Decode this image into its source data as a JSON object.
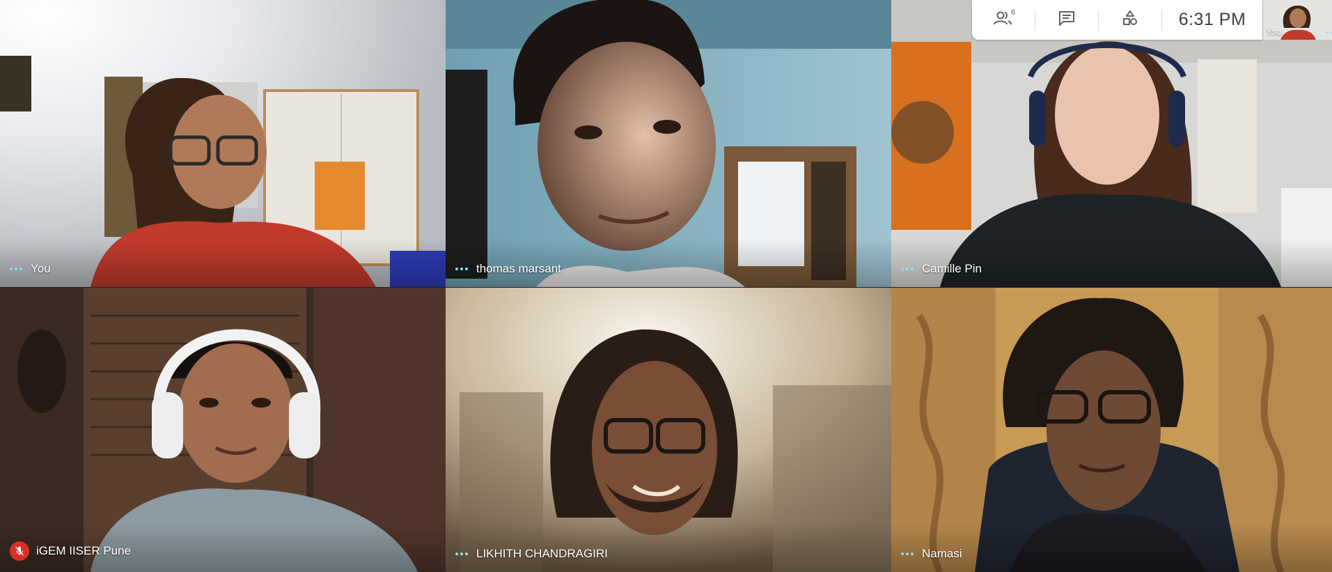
{
  "participants": [
    {
      "name": "You"
    },
    {
      "name": "thomas marsant"
    },
    {
      "name": "Camille Pin"
    },
    {
      "name": "iGEM IISER Pune",
      "muted": true
    },
    {
      "name": "LIKHITH CHANDRAGIRI"
    },
    {
      "name": "Namasi"
    }
  ],
  "topbar": {
    "people_icon": "people-icon",
    "people_count": "6",
    "chat_icon": "chat-icon",
    "activities_icon": "activities-icon",
    "time": "6:31  PM"
  },
  "self_view": {
    "label": "You"
  },
  "colors": {
    "speaking_dots": "#8ee0f0",
    "muted_badge": "#d93025"
  }
}
